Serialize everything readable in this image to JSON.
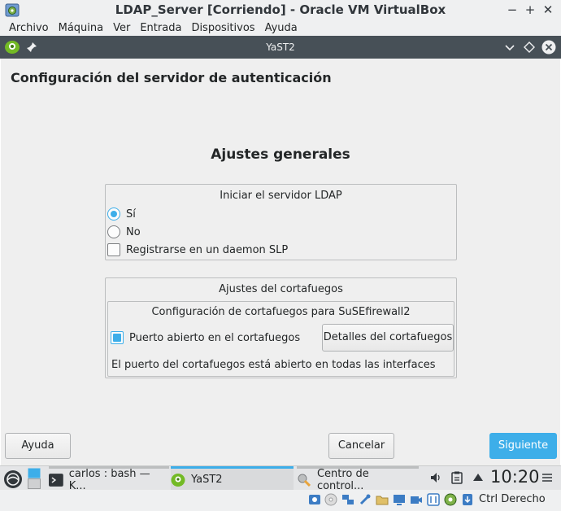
{
  "window": {
    "title": "LDAP_Server [Corriendo] - Oracle VM VirtualBox",
    "controls": {
      "minimize": "−",
      "maximize": "+",
      "close": "✕"
    }
  },
  "menubar": {
    "items": [
      "Archivo",
      "Máquina",
      "Ver",
      "Entrada",
      "Dispositivos",
      "Ayuda"
    ]
  },
  "yast_window": {
    "title": "YaST2"
  },
  "page": {
    "title": "Configuración del servidor de autenticación",
    "section_heading": "Ajustes generales"
  },
  "ldap_frame": {
    "title": "Iniciar el servidor LDAP",
    "options": [
      {
        "label": "Sí",
        "checked": true
      },
      {
        "label": "No",
        "checked": false
      }
    ],
    "slp_checkbox": {
      "label": "Registrarse en un daemon SLP",
      "checked": false
    }
  },
  "firewall_frame": {
    "title": "Ajustes del cortafuegos",
    "inner_title": "Configuración de cortafuegos para SuSEfirewall2",
    "open_port_checkbox": {
      "label": "Puerto abierto en el cortafuegos",
      "checked": true
    },
    "details_button": "Detalles del cortafuegos",
    "info": "El puerto del cortafuegos está abierto en todas las interfaces"
  },
  "buttons": {
    "help": "Ayuda",
    "cancel": "Cancelar",
    "next": "Siguiente"
  },
  "taskbar": {
    "tasks": [
      {
        "label": "carlos : bash — K...",
        "icon": "terminal-icon"
      },
      {
        "label": "YaST2",
        "icon": "yast-icon"
      },
      {
        "label": "Centro de control...",
        "icon": "control-center-icon"
      }
    ],
    "clock": "10:20"
  },
  "statusbar": {
    "host_key": "Ctrl Derecho"
  },
  "colors": {
    "accent": "#3daee9",
    "titlebar_dark": "#475057",
    "panel_bg": "#efefef"
  }
}
